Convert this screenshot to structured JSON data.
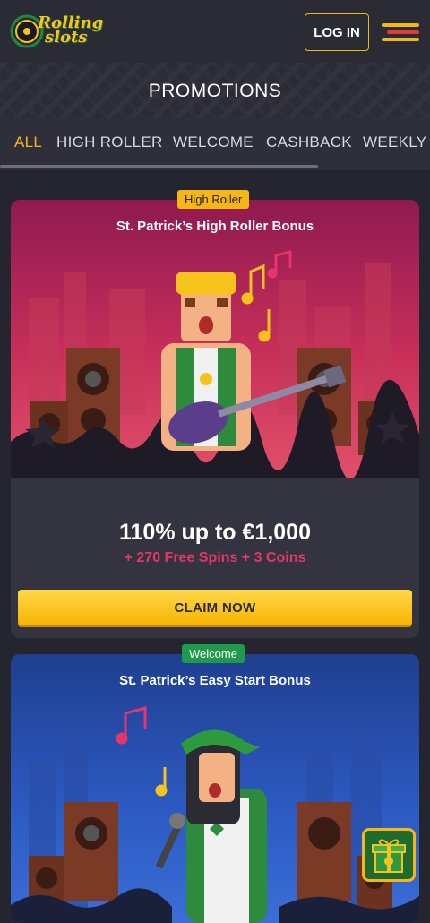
{
  "header": {
    "logo_text_line1": "Rolling",
    "logo_text_line2": "slots",
    "login_label": "LOG IN",
    "menu_icon": "hamburger-menu-icon"
  },
  "promotions": {
    "title": "PROMOTIONS"
  },
  "tabs": [
    {
      "label": "ALL",
      "active": true
    },
    {
      "label": "HIGH ROLLER",
      "active": false
    },
    {
      "label": "WELCOME",
      "active": false
    },
    {
      "label": "CASHBACK",
      "active": false
    },
    {
      "label": "WEEKLY",
      "active": false
    }
  ],
  "cards": [
    {
      "badge": "High Roller",
      "title": "St. Patrick’s High Roller Bonus",
      "amount": "110% up to €1,000",
      "extras": "+ 270 Free Spins + 3 Coins",
      "cta": "CLAIM NOW",
      "art": "guitarist-illustration"
    },
    {
      "badge": "Welcome",
      "title": "St. Patrick’s Easy Start Bonus",
      "art": "singer-illustration"
    }
  ],
  "floating": {
    "gift_icon": "gift-icon"
  },
  "colors": {
    "accent": "#f6b616",
    "extras_pink": "#e6356a",
    "welcome_green": "#1e9a4a",
    "background": "#24252f"
  }
}
